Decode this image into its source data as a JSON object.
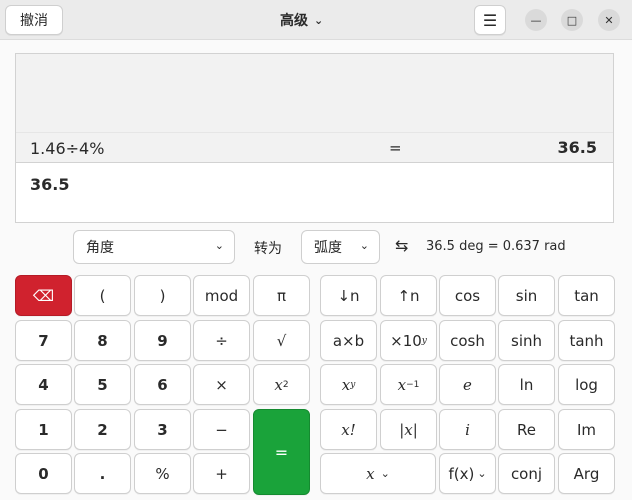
{
  "titlebar": {
    "undo_label": "撤消",
    "mode_title": "高级",
    "menu_icon": "hamburger-icon",
    "window_controls": [
      "minimize-icon",
      "maximize-icon",
      "close-icon"
    ]
  },
  "display": {
    "history": [
      {
        "expression": "1.46÷4%",
        "equals": "=",
        "result": "36.5"
      }
    ],
    "current_input": "36.5"
  },
  "conversion": {
    "from_unit": "角度",
    "to_label": "转为",
    "to_unit": "弧度",
    "result": "36.5 deg = 0.637 rad"
  },
  "keys": {
    "backspace": "⌫",
    "open_paren": "(",
    "close_paren": ")",
    "mod": "mod",
    "pi": "π",
    "down_shift": "↓n",
    "up_shift": "↑n",
    "cos": "cos",
    "sin": "sin",
    "tan": "tan",
    "seven": "7",
    "eight": "8",
    "nine": "9",
    "divide": "÷",
    "sqrt": "√",
    "multiply_ab": "a×b",
    "times_ten": "×10",
    "times_ten_sup": "y",
    "cosh": "cosh",
    "sinh": "sinh",
    "tanh": "tanh",
    "four": "4",
    "five": "5",
    "six": "6",
    "multiply": "×",
    "square_base": "x",
    "square_sup": "2",
    "power_base": "x",
    "power_sup": "y",
    "inverse_base": "x",
    "inverse_sup": "−1",
    "e": "e",
    "ln": "ln",
    "log": "log",
    "one": "1",
    "two": "2",
    "three": "3",
    "minus": "−",
    "equals": "=",
    "factorial": "x!",
    "abs": "|x|",
    "imag": "i",
    "re": "Re",
    "im": "Im",
    "zero": "0",
    "point": ".",
    "percent": "%",
    "plus": "+",
    "variable": "x",
    "function": "f(x)",
    "conj": "conj",
    "arg": "Arg"
  }
}
